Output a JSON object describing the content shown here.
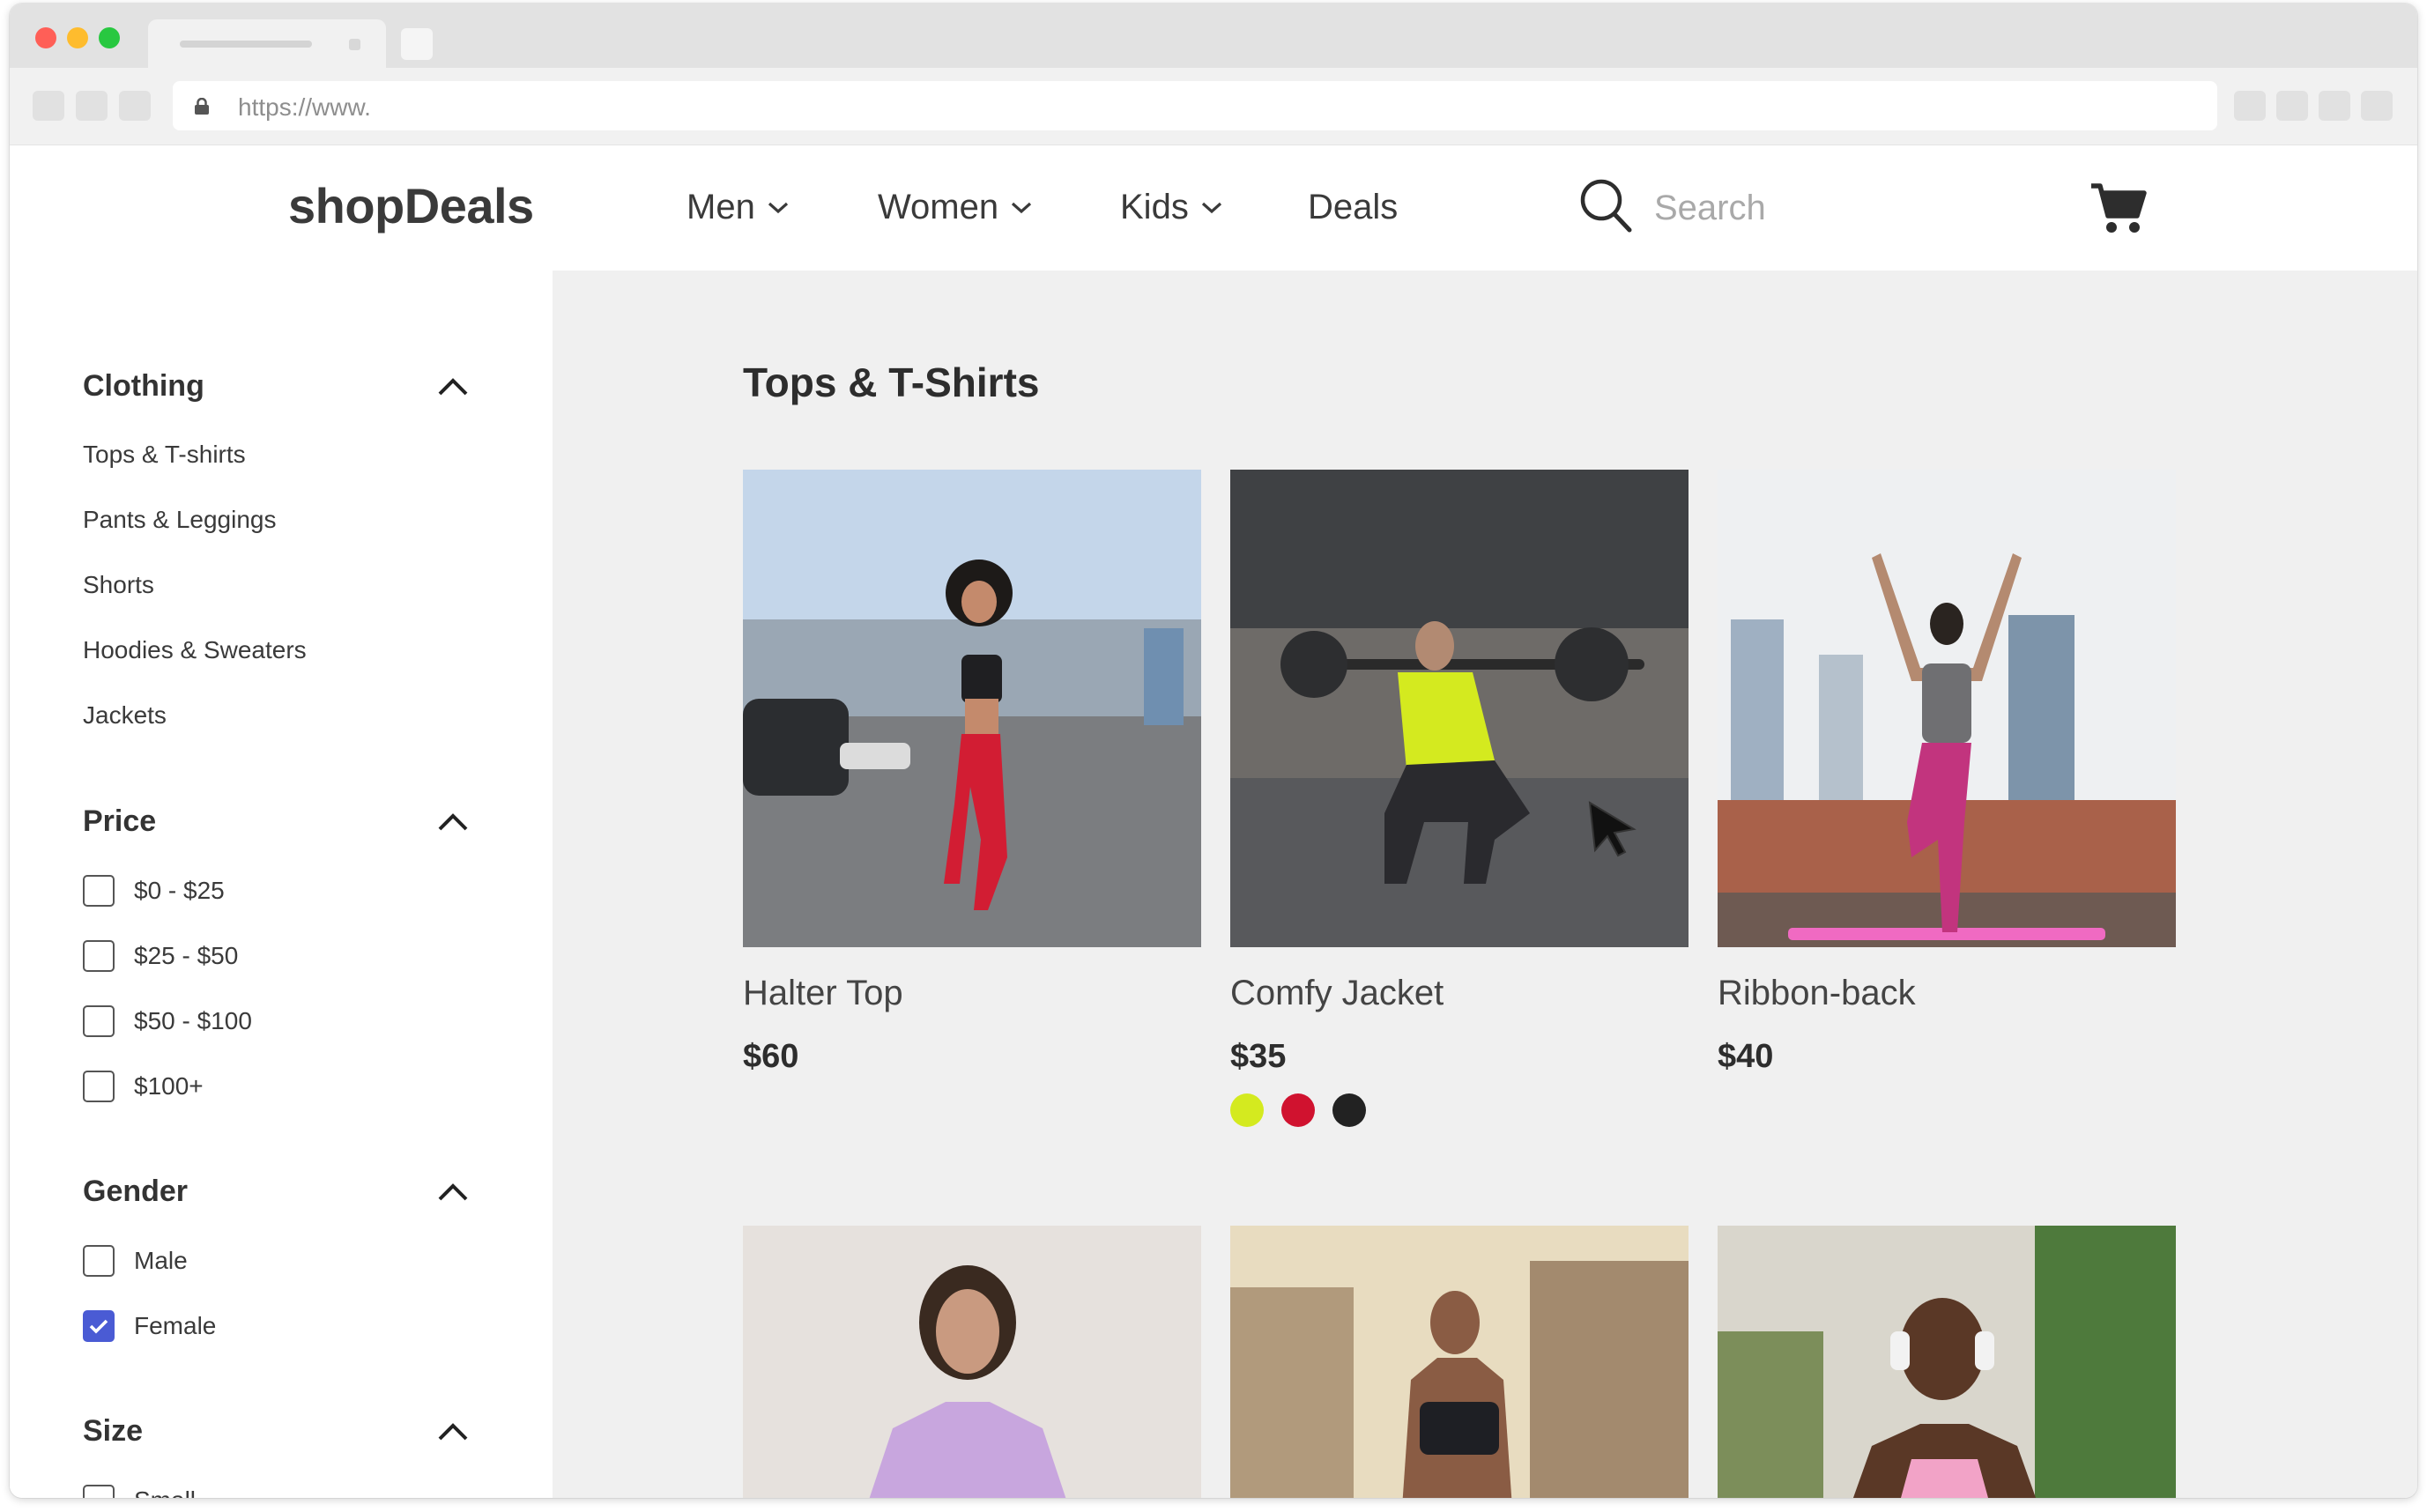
{
  "browser": {
    "url": "https://www."
  },
  "header": {
    "logo": "shopDeals",
    "nav": [
      {
        "label": "Men",
        "has_dropdown": true
      },
      {
        "label": "Women",
        "has_dropdown": true
      },
      {
        "label": "Kids",
        "has_dropdown": true
      },
      {
        "label": "Deals",
        "has_dropdown": false
      }
    ],
    "search_placeholder": "Search",
    "cart_icon": "cart-icon"
  },
  "sidebar": {
    "clothing": {
      "title": "Clothing",
      "items": [
        "Tops & T-shirts",
        "Pants & Leggings",
        "Shorts",
        "Hoodies & Sweaters",
        "Jackets"
      ]
    },
    "price": {
      "title": "Price",
      "options": [
        {
          "label": "$0 - $25",
          "checked": false
        },
        {
          "label": "$25 - $50",
          "checked": false
        },
        {
          "label": "$50 - $100",
          "checked": false
        },
        {
          "label": "$100+",
          "checked": false
        }
      ]
    },
    "gender": {
      "title": "Gender",
      "options": [
        {
          "label": "Male",
          "checked": false
        },
        {
          "label": "Female",
          "checked": true
        }
      ]
    },
    "size": {
      "title": "Size",
      "options": [
        {
          "label": "Small",
          "checked": false
        }
      ]
    }
  },
  "main": {
    "title": "Tops & T-Shirts",
    "products": [
      {
        "name": "Halter Top",
        "price": "$60",
        "swatches": []
      },
      {
        "name": "Comfy Jacket",
        "price": "$35",
        "swatches": [
          "#d4ea1f",
          "#d0122f",
          "#222222"
        ]
      },
      {
        "name": "Ribbon-back",
        "price": "$40",
        "swatches": []
      }
    ]
  },
  "colors": {
    "accent": "#4a5bd4",
    "page_bg": "#f0f0f0"
  }
}
